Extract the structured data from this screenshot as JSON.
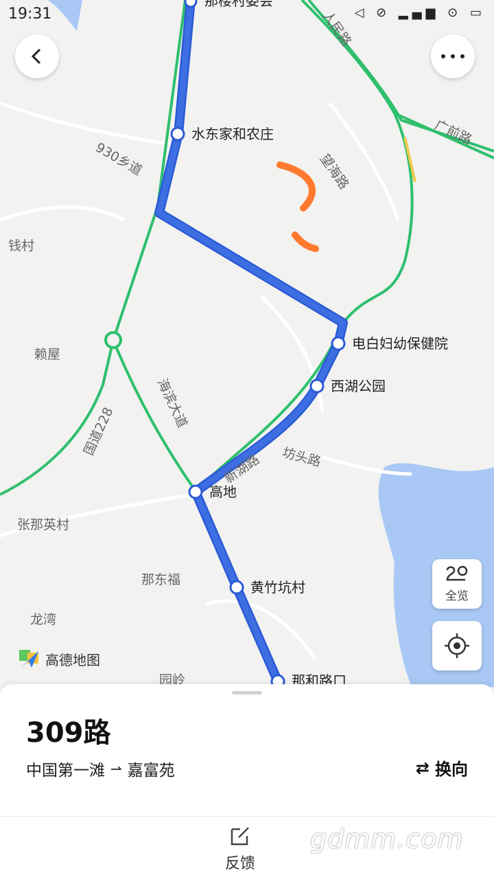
{
  "status_bar": {
    "time": "19:31",
    "icons": "◁ ⊘ ▂▄▆ ⊙ ▭"
  },
  "map": {
    "brand": "高德地图",
    "stops": [
      "那楼村委会",
      "水东家和农庄",
      "电白妇幼保健院",
      "西湖公园",
      "高地",
      "黄竹坑村",
      "那和路口"
    ],
    "places": [
      "钱村",
      "赖屋",
      "张那英村",
      "那东福",
      "龙湾",
      "园岭"
    ],
    "roads": [
      "人民路",
      "广前路",
      "930乡道",
      "望海路",
      "新湖路",
      "坊头路",
      "国道228",
      "海滨大道"
    ]
  },
  "controls": {
    "overview_label": "全览"
  },
  "route": {
    "name": "309路",
    "from": "中国第一滩",
    "to": "嘉富苑",
    "switch_label": "换向"
  },
  "footer": {
    "feedback_label": "反馈",
    "watermark": "gdmm.com"
  },
  "colors": {
    "route": "#3d6fe3",
    "road": "#2fbf6e",
    "water": "#a9c8f5",
    "marker": "#ff7a2e"
  }
}
